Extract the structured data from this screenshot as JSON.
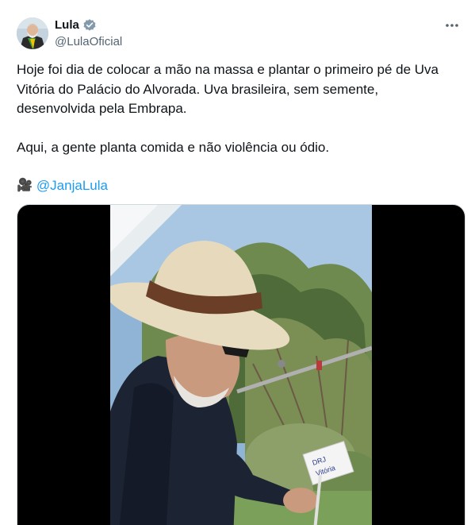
{
  "author": {
    "display_name": "Lula",
    "handle": "@LulaOficial",
    "verified": true,
    "verified_color": "#829aab"
  },
  "tweet": {
    "paragraph_1": "Hoje foi dia de colocar a mão na massa e plantar o primeiro pé de Uva Vitória do Palácio do Alvorada. Uva brasileira, sem semente, desenvolvida pela Embrapa.",
    "paragraph_2": "Aqui, a gente planta comida e não violência ou ódio.",
    "credit_emoji": "🎥",
    "credit_mention": "@JanjaLula"
  },
  "media": {
    "type": "video",
    "tag_text": "DRJ Vitória",
    "letterbox_color": "#000000"
  },
  "icons": {
    "more": "more-horizontal-icon",
    "verified": "verified-badge-icon"
  },
  "colors": {
    "text": "#0f1419",
    "secondary": "#536471",
    "link": "#1d9bf0"
  }
}
